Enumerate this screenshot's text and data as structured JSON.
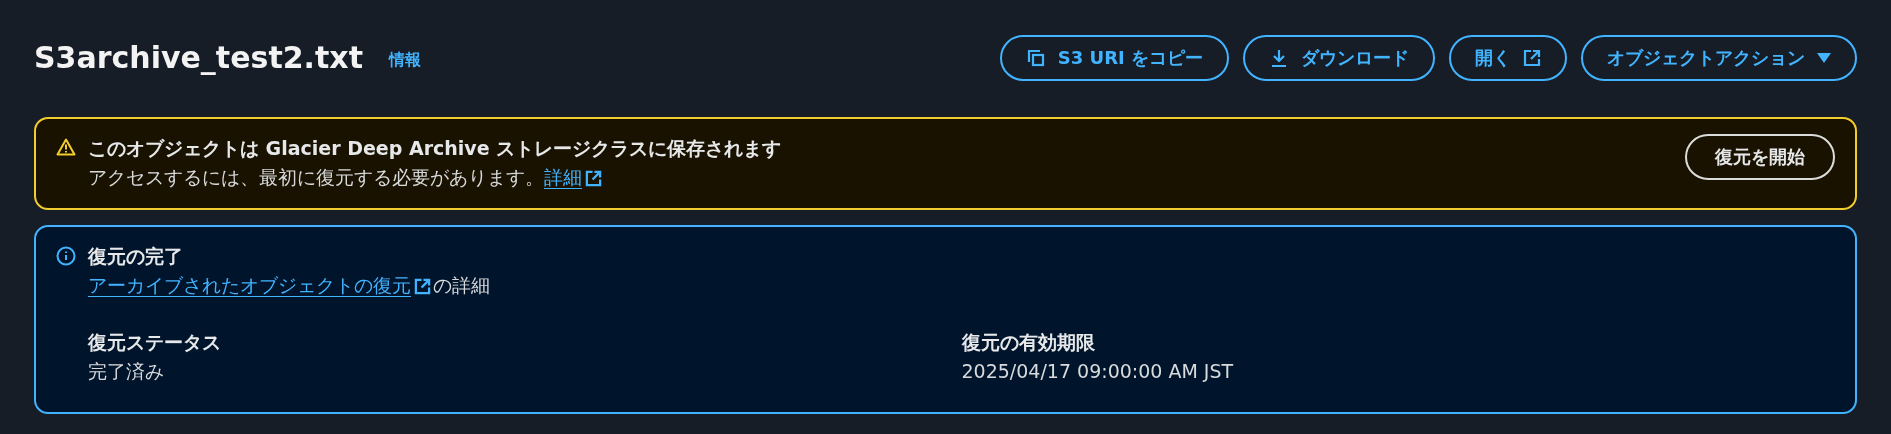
{
  "header": {
    "title": "S3archive_test2.txt",
    "info_link": "情報",
    "actions": [
      {
        "label": "S3 URI をコピー",
        "kind": "copy"
      },
      {
        "label": "ダウンロード",
        "kind": "download"
      },
      {
        "label": "開く",
        "kind": "external"
      },
      {
        "label": "オブジェクトアクション",
        "kind": "dropdown"
      }
    ]
  },
  "alerts": [
    {
      "kind": "warning",
      "title": "このオブジェクトは Glacier Deep Archive ストレージクラスに保存されます",
      "text": "アクセスするには、最初に復元する必要があります。",
      "link": "詳細",
      "button": "復元を開始"
    },
    {
      "kind": "info",
      "title": "復元の完了",
      "link": "アーカイブされたオブジェクトの復元",
      "text_after": "の詳細",
      "fields": [
        {
          "label": "復元ステータス",
          "value": "完了済み"
        },
        {
          "label": "復元の有効期限",
          "value": "2025/04/17 09:00:00 AM JST"
        }
      ]
    }
  ]
}
